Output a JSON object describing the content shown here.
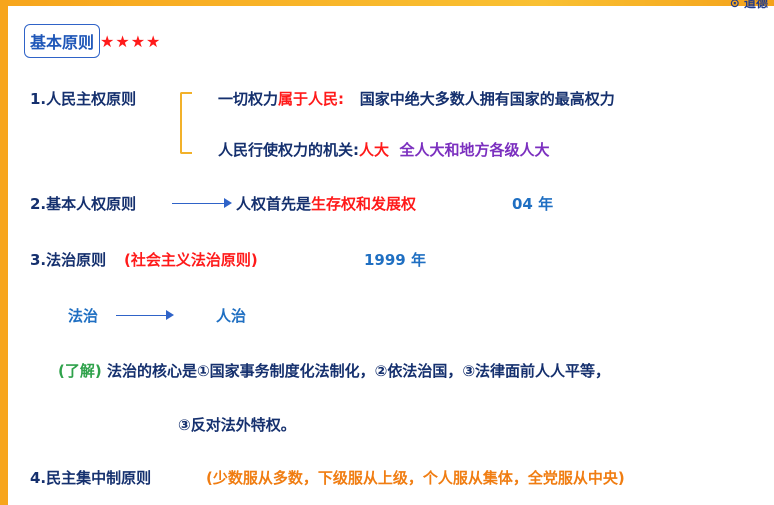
{
  "top_tag": "⊙ 道德",
  "header": {
    "title": "基本原则",
    "stars": "★★★★"
  },
  "principles": {
    "p1": {
      "label": "1.人民主权原则",
      "line1_prefix": "一切权力",
      "line1_highlight": "属于人民:",
      "line1_rest": "国家中绝大多数人拥有国家的最高权力",
      "line2_prefix": "人民行使权力的机关:",
      "line2_highlight": "人大",
      "line2_rest": "全人大和地方各级人大"
    },
    "p2": {
      "label": "2.基本人权原则",
      "text_prefix": "人权首先是",
      "text_highlight": "生存权和发展权",
      "year": "04 年"
    },
    "p3": {
      "label": "3.法治原则",
      "paren": "(社会主义法治原则)",
      "year": "1999 年",
      "contrast_left": "法治",
      "contrast_right": "人治",
      "note_tag": "(了解)",
      "note_text": "法治的核心是①国家事务制度化法制化，②依法治国，③法律面前人人平等，",
      "note_cont": "③反对法外特权。"
    },
    "p4": {
      "label": "4.民主集中制原则",
      "paren": "(少数服从多数，下级服从上级，个人服从集体，全党服从中央)"
    }
  },
  "colors": {
    "navy": "#15306e",
    "red": "#ff1a1a",
    "blue": "#1f6fc2",
    "purple": "#7b2fbf",
    "green": "#2fa24b",
    "orange": "#f07d12",
    "accent_bar": "#f7a51c"
  }
}
